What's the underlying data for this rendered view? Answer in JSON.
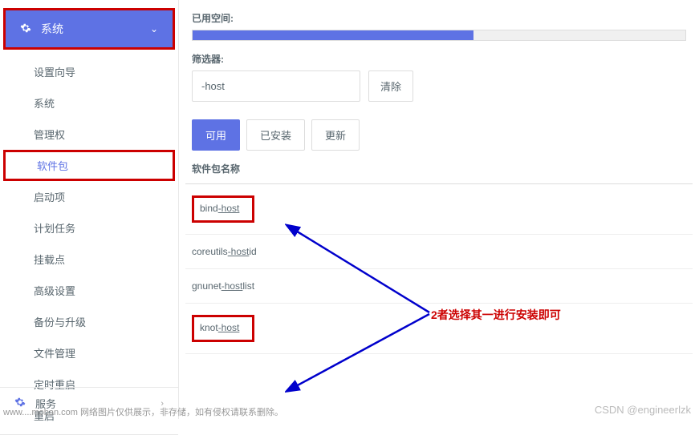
{
  "sidebar": {
    "header": {
      "label": "系统"
    },
    "items": [
      {
        "label": "设置向导"
      },
      {
        "label": "系统"
      },
      {
        "label": "管理权"
      },
      {
        "label": "软件包"
      },
      {
        "label": "启动项"
      },
      {
        "label": "计划任务"
      },
      {
        "label": "挂载点"
      },
      {
        "label": "高级设置"
      },
      {
        "label": "备份与升级"
      },
      {
        "label": "文件管理"
      },
      {
        "label": "定时重启"
      },
      {
        "label": "重启"
      }
    ],
    "footer": {
      "label": "服务"
    }
  },
  "main": {
    "space": {
      "label": "已用空间:",
      "progress_percent": 57
    },
    "filter": {
      "label": "筛选器:",
      "input_value": "-host",
      "clear_label": "清除"
    },
    "tabs": [
      {
        "label": "可用",
        "active": true
      },
      {
        "label": "已安装",
        "active": false
      },
      {
        "label": "更新",
        "active": false
      }
    ],
    "table_header": "软件包名称",
    "packages": [
      {
        "prefix": "bind",
        "underlined": "-host",
        "highlighted": true
      },
      {
        "prefix": "coreutils",
        "underlined": "-host",
        "suffix": "id",
        "highlighted": false
      },
      {
        "prefix": "gnunet",
        "underlined": "-host",
        "suffix": "list",
        "highlighted": false
      },
      {
        "prefix": "knot",
        "underlined": "-host",
        "highlighted": true
      }
    ]
  },
  "annotation": {
    "text": "2者选择其一进行安装即可"
  },
  "watermark": "CSDN @engineerlzk",
  "bottom_note": "www....moban.com  网络图片仅供展示，非存储，如有侵权请联系删除。",
  "colors": {
    "accent": "#5e72e4",
    "highlight": "#c00"
  }
}
